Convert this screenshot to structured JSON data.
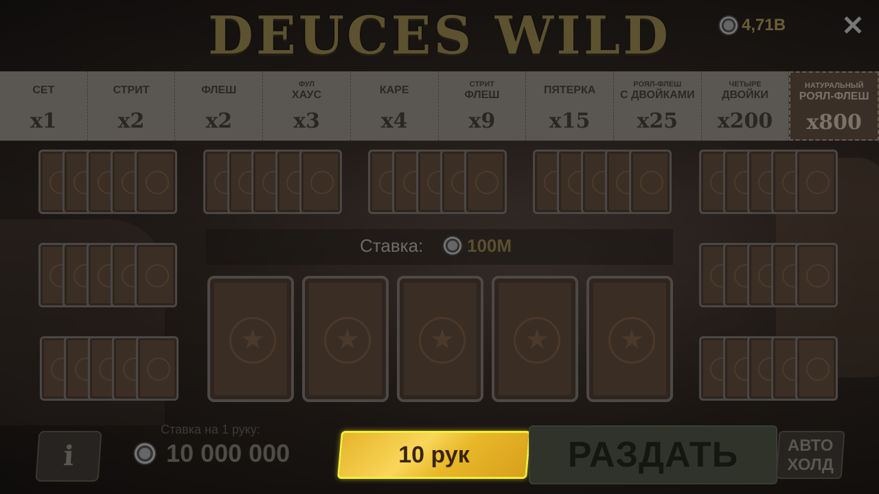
{
  "header": {
    "title": "DEUCES WILD",
    "balance": "4,71B",
    "close_icon": "close-icon"
  },
  "paytable": [
    {
      "name": "СЕТ",
      "mult": "x1"
    },
    {
      "name": "СТРИТ",
      "mult": "x2"
    },
    {
      "name": "ФЛЕШ",
      "mult": "x2"
    },
    {
      "line1": "ФУЛ",
      "line2": "ХАУС",
      "mult": "x3"
    },
    {
      "name": "КАРЕ",
      "mult": "x4"
    },
    {
      "line1": "СТРИТ",
      "line2": "ФЛЕШ",
      "mult": "x9"
    },
    {
      "name": "ПЯТЕРКА",
      "mult": "x15"
    },
    {
      "line1": "РОЯЛ-ФЛЕШ",
      "line2": "С ДВОЙКАМИ",
      "mult": "x25"
    },
    {
      "line1": "ЧЕТЫРЕ",
      "line2": "ДВОЙКИ",
      "mult": "x200"
    },
    {
      "line1": "НАТУРАЛЬНЫЙ",
      "line2": "РОЯЛ-ФЛЕШ",
      "mult": "x800"
    }
  ],
  "bet": {
    "label": "Ставка:",
    "value": "100M"
  },
  "controls": {
    "info_label": "i",
    "per_hand_label": "Ставка на 1 руку:",
    "per_hand_value": "10 000 000",
    "hands_label": "10 рук",
    "deal_label": "РАЗДАТЬ",
    "auto_line1": "АВТО",
    "auto_line2": "ХОЛД"
  }
}
